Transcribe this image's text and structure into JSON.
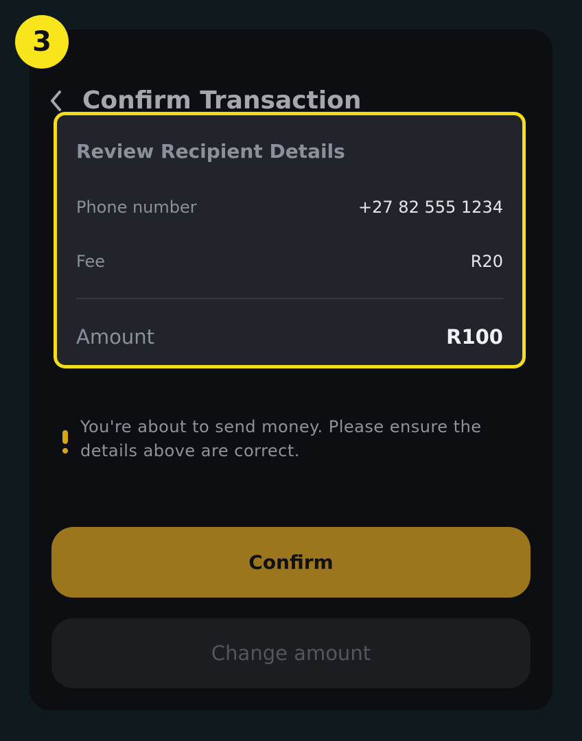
{
  "step_badge": "3",
  "header": {
    "title": "Confirm Transaction",
    "back_icon": "chevron-left-icon"
  },
  "details": {
    "title": "Review Recipient Details",
    "phone_label": "Phone number",
    "phone_value": "+27 82 555 1234",
    "fee_label": "Fee",
    "fee_value": "R20",
    "amount_label": "Amount",
    "amount_value": "R100",
    "highlight_color": "#f1dd1b"
  },
  "warning": {
    "icon": "exclamation-icon",
    "text": "You're about to send money. Please ensure the details above are correct."
  },
  "actions": {
    "confirm_label": "Confirm",
    "change_label": "Change amount"
  },
  "colors": {
    "accent": "#9b761c",
    "badge": "#f9e51c",
    "background": "#0c0e11",
    "card": "#22242c"
  }
}
